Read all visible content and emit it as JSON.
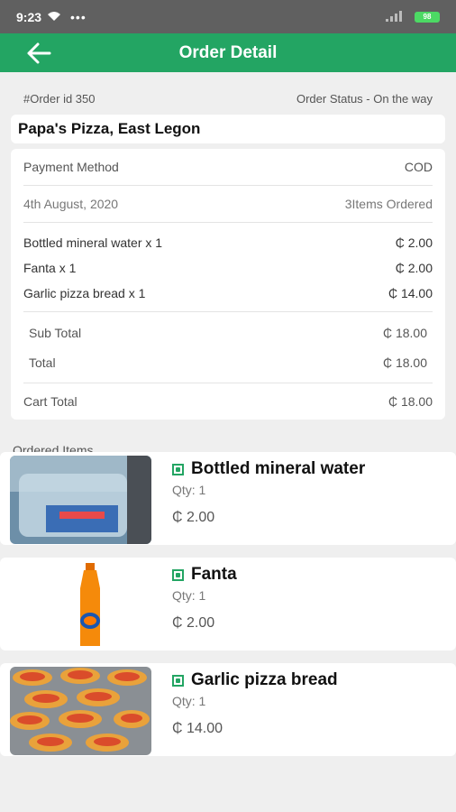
{
  "status_bar": {
    "time": "9:23",
    "dots": "•••",
    "battery": "98"
  },
  "appbar": {
    "title": "Order Detail"
  },
  "order": {
    "id_label": "#Order id 350",
    "status": "Order Status - On the way"
  },
  "shop_name": "Papa's Pizza, East Legon",
  "summary": {
    "payment_label": "Payment Method",
    "payment_value": "COD",
    "date": "4th August, 2020",
    "items_ordered": "3Items Ordered",
    "lines": [
      {
        "name": "Bottled mineral water  x 1",
        "price": "₵ 2.00"
      },
      {
        "name": "Fanta  x 1",
        "price": "₵ 2.00"
      },
      {
        "name": "Garlic pizza bread  x 1",
        "price": "₵ 14.00"
      }
    ],
    "subtotal_label": "Sub Total",
    "subtotal_value": "₵ 18.00",
    "total_label": "Total",
    "total_value": "₵ 18.00",
    "cart_total_label": "Cart Total",
    "cart_total_value": "₵ 18.00"
  },
  "ordered_items_label": "Ordered Items",
  "items": [
    {
      "name": "Bottled mineral water",
      "qty": "Qty: 1",
      "price": "₵ 2.00"
    },
    {
      "name": "Fanta",
      "qty": "Qty: 1",
      "price": "₵ 2.00"
    },
    {
      "name": "Garlic pizza bread",
      "qty": "Qty: 1",
      "price": "₵ 14.00"
    }
  ],
  "colors": {
    "primary": "#23a563",
    "status_bar": "#606060",
    "background": "#efefef"
  }
}
